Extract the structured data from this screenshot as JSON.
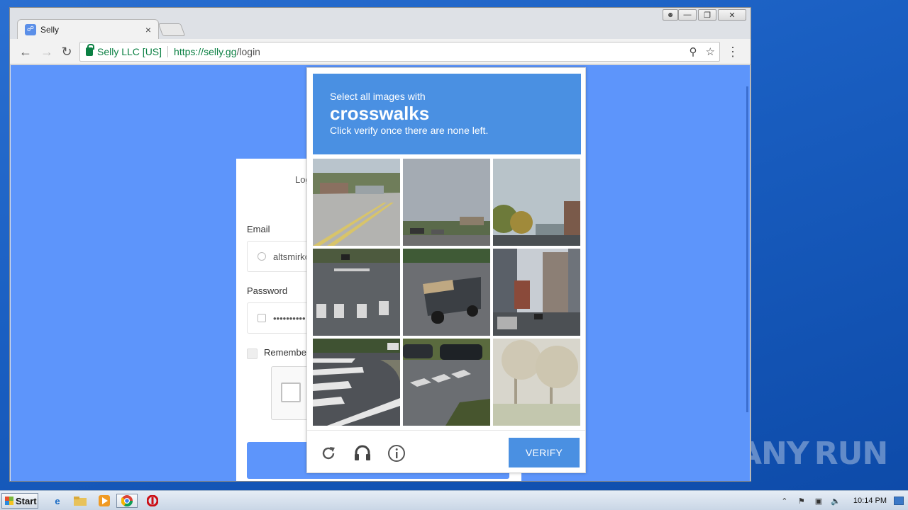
{
  "browser": {
    "tab_title": "Selly",
    "tab_close": "×",
    "security_label": "Selly LLC [US]",
    "url_scheme_host": "https://selly.gg",
    "url_path": "/login",
    "key_icon": "key-icon",
    "star_icon": "star-icon",
    "menu_icon": "kebab-menu-icon"
  },
  "login": {
    "header_partial": "Log",
    "email_label": "Email",
    "email_value": "altsmirko",
    "password_label": "Password",
    "password_value": "••••••••••",
    "remember_label": "Remember"
  },
  "captcha": {
    "instruction": "Select all images with",
    "target": "crosswalks",
    "hint": "Click verify once there are none left.",
    "verify_label": "VERIFY",
    "tiles": [
      {
        "scene": "road intersection with yellow lines"
      },
      {
        "scene": "empty sky over parked cars"
      },
      {
        "scene": "street with autumn trees"
      },
      {
        "scene": "wide crosswalk on road"
      },
      {
        "scene": "pickup truck on road"
      },
      {
        "scene": "city street with high-rise buildings"
      },
      {
        "scene": "crosswalk at curb corner"
      },
      {
        "scene": "crosswalk with parked cars"
      },
      {
        "scene": "faded park with trees"
      }
    ],
    "footer_icons": [
      "refresh-icon",
      "audio-icon",
      "info-icon"
    ]
  },
  "watermark": {
    "left": "ANY",
    "right": "RUN"
  },
  "taskbar": {
    "start_label": "Start",
    "clock": "10:14 PM"
  },
  "colors": {
    "page_bg": "#5d95fb",
    "captcha_blue": "#4a90e2",
    "secure_green": "#0b8043"
  }
}
